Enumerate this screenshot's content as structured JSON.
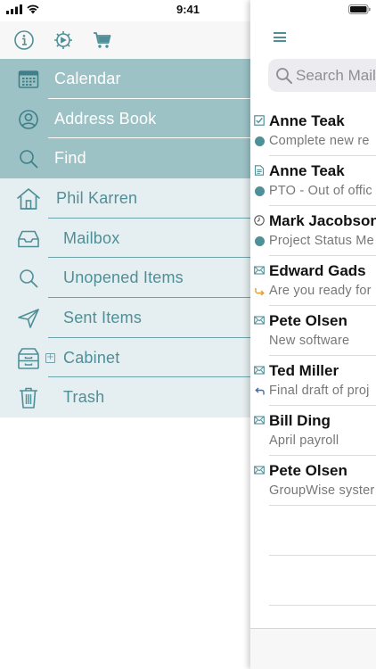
{
  "status_bar": {
    "time": "9:41",
    "signal_icon": "cellular-signal-icon",
    "wifi_icon": "wifi-icon",
    "battery_icon": "battery-icon"
  },
  "toolbar": {
    "buttons": [
      {
        "name": "info-icon"
      },
      {
        "name": "settings-gear-icon"
      },
      {
        "name": "cart-icon"
      }
    ]
  },
  "nav": {
    "top_items": [
      {
        "label": "Calendar",
        "icon": "calendar-icon"
      },
      {
        "label": "Address Book",
        "icon": "person-icon"
      },
      {
        "label": "Find",
        "icon": "search-icon"
      }
    ],
    "bottom_items": [
      {
        "label": "Phil Karren",
        "icon": "home-icon"
      },
      {
        "label": "Mailbox",
        "icon": "inbox-tray-icon"
      },
      {
        "label": "Unopened Items",
        "icon": "search-icon"
      },
      {
        "label": "Sent Items",
        "icon": "paper-plane-icon"
      },
      {
        "label": "Cabinet",
        "icon": "cabinet-icon",
        "expand": "+"
      },
      {
        "label": "Trash",
        "icon": "trash-icon"
      }
    ]
  },
  "search": {
    "placeholder": "Search Mail"
  },
  "messages": [
    {
      "from": "Anne Teak",
      "subject": "Complete new re",
      "type_icon": "task-check-icon",
      "status_icon": "unread-dot-icon"
    },
    {
      "from": "Anne Teak",
      "subject": "PTO - Out of offic",
      "type_icon": "note-icon",
      "status_icon": "unread-dot-icon"
    },
    {
      "from": "Mark Jacobson",
      "subject": "Project Status Me",
      "type_icon": "appointment-clock-icon",
      "status_icon": "unread-dot-icon"
    },
    {
      "from": "Edward Gads",
      "subject": "Are you ready for",
      "type_icon": "mail-envelope-icon",
      "status_icon": "forwarded-arrow-icon"
    },
    {
      "from": "Pete Olsen",
      "subject": "New software",
      "type_icon": "mail-envelope-icon",
      "status_icon": ""
    },
    {
      "from": "Ted Miller",
      "subject": "Final draft of proj",
      "type_icon": "mail-envelope-icon",
      "status_icon": "replied-arrow-icon"
    },
    {
      "from": "Bill Ding",
      "subject": "April payroll",
      "type_icon": "mail-envelope-icon",
      "status_icon": ""
    },
    {
      "from": "Pete Olsen",
      "subject": "GroupWise syster",
      "type_icon": "mail-envelope-icon",
      "status_icon": ""
    }
  ],
  "colors": {
    "accent": "#4f8f97",
    "nav_top_bg": "#9cc2c6",
    "nav_bottom_bg": "#e5eef0",
    "unread_dot": "#4f8f97",
    "forward_arrow": "#e0a030",
    "reply_arrow": "#3d6fb0"
  }
}
